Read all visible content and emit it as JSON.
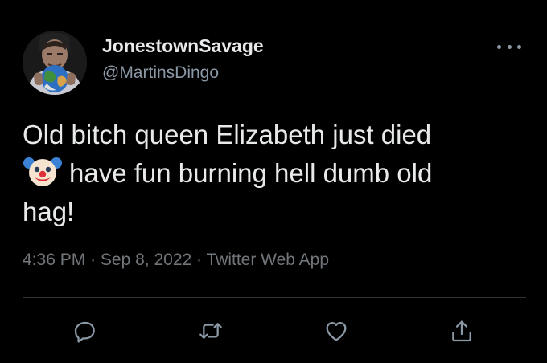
{
  "tweet": {
    "author": {
      "display_name": "JonestownSavage",
      "handle": "@MartinsDingo",
      "avatar_icon": "avatar"
    },
    "text_lines": [
      "Old bitch queen Elizabeth just died",
      "have fun burning hell dumb old",
      "hag!"
    ],
    "emoji": "clown-face-icon",
    "time": "4:36 PM",
    "date": "Sep 8, 2022",
    "source": "Twitter Web App",
    "separator": "·"
  },
  "actions": [
    {
      "name": "reply",
      "icon": "reply-icon"
    },
    {
      "name": "retweet",
      "icon": "retweet-icon"
    },
    {
      "name": "like",
      "icon": "heart-icon"
    },
    {
      "name": "share",
      "icon": "share-icon"
    }
  ],
  "colors": {
    "background": "#000000",
    "primary_text": "#e7e9ea",
    "secondary_text": "#71767b",
    "divider": "#2f3336"
  }
}
